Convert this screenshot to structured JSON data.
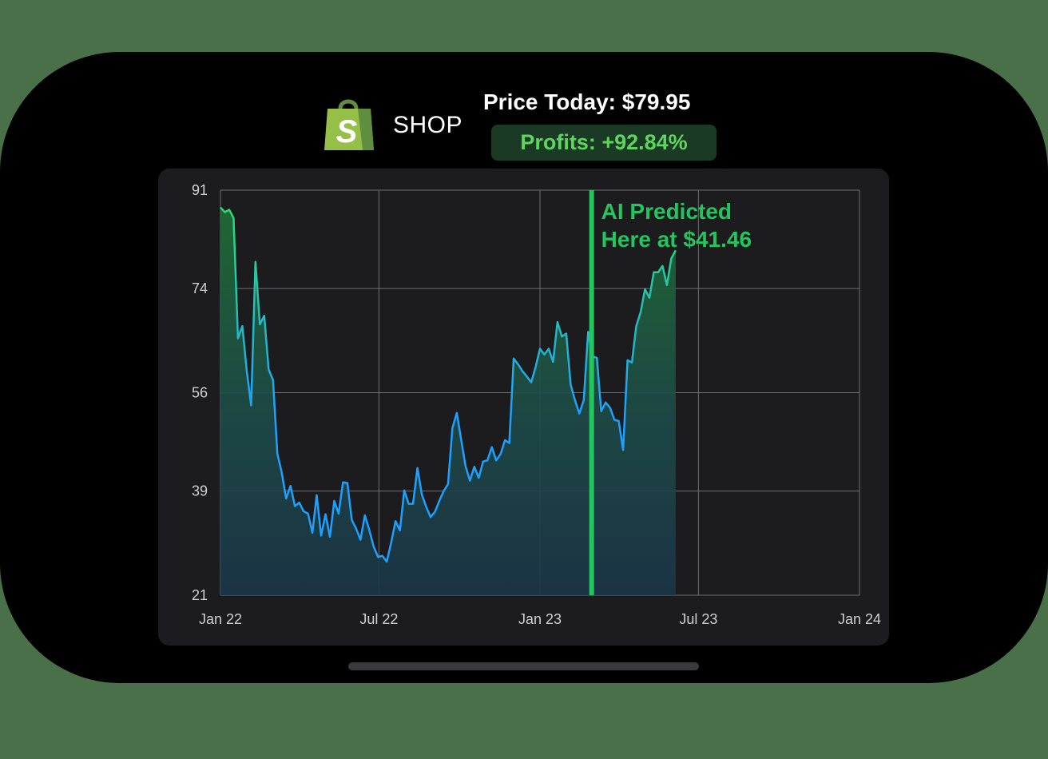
{
  "header": {
    "logo_icon": "shopify-bag-icon",
    "logo_letter": "S",
    "ticker": "SHOP",
    "price_today": "Price Today: $79.95",
    "profits": "Profits: +92.84%"
  },
  "colors": {
    "background": "#4a7049",
    "card": "#1c1c1e",
    "accent_green": "#22c55e",
    "line_up": "#2ecc71",
    "line_down": "#1ea0ff",
    "grid": "#6e6e73"
  },
  "chart_data": {
    "type": "line",
    "title": "",
    "xlabel": "",
    "ylabel": "",
    "ylim": [
      21,
      91
    ],
    "yticks": [
      21,
      39,
      56,
      74,
      91
    ],
    "xticks": [
      "Jan 22",
      "Jul 22",
      "Jan 23",
      "Jul 23",
      "Jan 24"
    ],
    "xtick_dates": [
      "2022-01-01",
      "2022-07-01",
      "2023-01-01",
      "2023-07-01",
      "2024-01-01"
    ],
    "xlim": [
      "2022-01-01",
      "2024-01-01"
    ],
    "grid": true,
    "annotation": {
      "date": "2023-03-01",
      "line1": "AI Predicted",
      "line2": "Here at $41.46",
      "value": 41.46
    },
    "series": [
      {
        "values": [
          [
            "2022-01-01",
            88.0
          ],
          [
            "2022-01-06",
            87.2
          ],
          [
            "2022-01-11",
            87.6
          ],
          [
            "2022-01-16",
            86.2
          ],
          [
            "2022-01-21",
            65.4
          ],
          [
            "2022-01-26",
            67.5
          ],
          [
            "2022-01-31",
            59.8
          ],
          [
            "2022-02-05",
            53.8
          ],
          [
            "2022-02-10",
            78.6
          ],
          [
            "2022-02-15",
            67.8
          ],
          [
            "2022-02-20",
            69.3
          ],
          [
            "2022-02-25",
            60.0
          ],
          [
            "2022-03-02",
            58.2
          ],
          [
            "2022-03-07",
            45.5
          ],
          [
            "2022-03-12",
            42.2
          ],
          [
            "2022-03-17",
            37.7
          ],
          [
            "2022-03-22",
            39.9
          ],
          [
            "2022-03-27",
            36.4
          ],
          [
            "2022-04-01",
            37.0
          ],
          [
            "2022-04-06",
            35.5
          ],
          [
            "2022-04-11",
            35.1
          ],
          [
            "2022-04-16",
            31.8
          ],
          [
            "2022-04-21",
            38.3
          ],
          [
            "2022-04-26",
            31.3
          ],
          [
            "2022-05-01",
            35.0
          ],
          [
            "2022-05-06",
            31.1
          ],
          [
            "2022-05-11",
            37.3
          ],
          [
            "2022-05-16",
            35.1
          ],
          [
            "2022-05-21",
            40.5
          ],
          [
            "2022-05-26",
            40.4
          ],
          [
            "2022-05-31",
            34.0
          ],
          [
            "2022-06-05",
            32.5
          ],
          [
            "2022-06-10",
            30.6
          ],
          [
            "2022-06-15",
            34.8
          ],
          [
            "2022-06-20",
            32.3
          ],
          [
            "2022-06-25",
            29.4
          ],
          [
            "2022-06-30",
            27.6
          ],
          [
            "2022-07-05",
            27.8
          ],
          [
            "2022-07-10",
            26.8
          ],
          [
            "2022-07-15",
            30.1
          ],
          [
            "2022-07-20",
            33.8
          ],
          [
            "2022-07-25",
            32.2
          ],
          [
            "2022-07-30",
            39.1
          ],
          [
            "2022-08-04",
            36.8
          ],
          [
            "2022-08-09",
            36.8
          ],
          [
            "2022-08-14",
            43.0
          ],
          [
            "2022-08-19",
            38.4
          ],
          [
            "2022-08-24",
            36.3
          ],
          [
            "2022-08-29",
            34.5
          ],
          [
            "2022-09-03",
            35.4
          ],
          [
            "2022-09-08",
            37.3
          ],
          [
            "2022-09-13",
            39.0
          ],
          [
            "2022-09-18",
            40.2
          ],
          [
            "2022-09-23",
            49.9
          ],
          [
            "2022-09-28",
            52.5
          ],
          [
            "2022-10-03",
            47.8
          ],
          [
            "2022-10-08",
            43.3
          ],
          [
            "2022-10-13",
            40.8
          ],
          [
            "2022-10-18",
            43.2
          ],
          [
            "2022-10-23",
            41.3
          ],
          [
            "2022-10-28",
            44.1
          ],
          [
            "2022-11-02",
            44.3
          ],
          [
            "2022-11-07",
            46.6
          ],
          [
            "2022-11-12",
            44.3
          ],
          [
            "2022-11-17",
            45.4
          ],
          [
            "2022-11-22",
            47.8
          ],
          [
            "2022-11-27",
            47.3
          ],
          [
            "2022-12-02",
            61.9
          ],
          [
            "2022-12-07",
            60.9
          ],
          [
            "2022-12-12",
            59.7
          ],
          [
            "2022-12-17",
            58.8
          ],
          [
            "2022-12-22",
            57.8
          ],
          [
            "2022-12-27",
            60.4
          ],
          [
            "2023-01-01",
            63.6
          ],
          [
            "2023-01-06",
            62.6
          ],
          [
            "2023-01-11",
            63.6
          ],
          [
            "2023-01-16",
            61.3
          ],
          [
            "2023-01-21",
            68.2
          ],
          [
            "2023-01-26",
            65.7
          ],
          [
            "2023-01-31",
            66.2
          ],
          [
            "2023-02-05",
            57.4
          ],
          [
            "2023-02-10",
            54.7
          ],
          [
            "2023-02-15",
            52.4
          ],
          [
            "2023-02-20",
            54.7
          ],
          [
            "2023-02-25",
            66.5
          ],
          [
            "2023-03-02",
            62.3
          ],
          [
            "2023-03-07",
            62.0
          ],
          [
            "2023-03-12",
            52.8
          ],
          [
            "2023-03-17",
            54.3
          ],
          [
            "2023-03-22",
            53.4
          ],
          [
            "2023-03-27",
            51.3
          ],
          [
            "2023-04-01",
            51.1
          ],
          [
            "2023-04-06",
            46.1
          ],
          [
            "2023-04-11",
            61.6
          ],
          [
            "2023-04-16",
            61.2
          ],
          [
            "2023-04-21",
            67.5
          ],
          [
            "2023-04-26",
            69.9
          ],
          [
            "2023-05-01",
            73.9
          ],
          [
            "2023-05-06",
            72.4
          ],
          [
            "2023-05-11",
            76.8
          ],
          [
            "2023-05-16",
            76.8
          ],
          [
            "2023-05-21",
            77.9
          ],
          [
            "2023-05-26",
            74.6
          ],
          [
            "2023-05-31",
            79.2
          ],
          [
            "2023-06-05",
            80.6
          ]
        ]
      }
    ]
  }
}
